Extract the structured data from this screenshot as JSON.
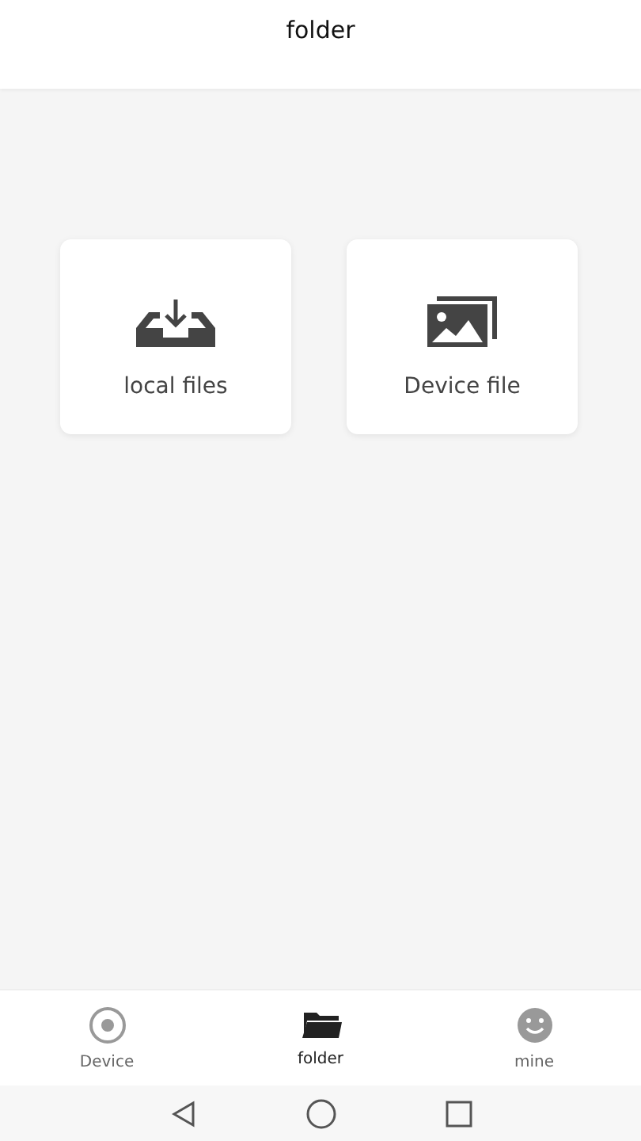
{
  "header": {
    "title": "folder"
  },
  "cards": [
    {
      "kind": "download",
      "label": "local files"
    },
    {
      "kind": "images",
      "label": "Device file"
    }
  ],
  "tabs": [
    {
      "kind": "disc",
      "label": "Device",
      "selected": false
    },
    {
      "kind": "folder",
      "label": "folder",
      "selected": true
    },
    {
      "kind": "smile",
      "label": "mine",
      "selected": false
    }
  ]
}
